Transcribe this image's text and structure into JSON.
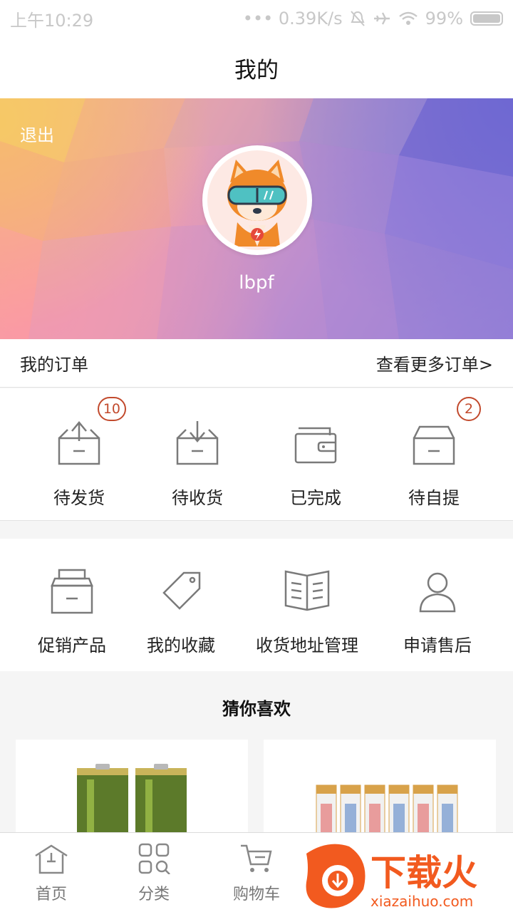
{
  "status_bar": {
    "time": "上午10:29",
    "speed": "••• 0.39K/s",
    "battery": "99%"
  },
  "header": {
    "title": "我的"
  },
  "profile": {
    "logout_label": "退出",
    "username": "lbpf"
  },
  "orders": {
    "title": "我的订单",
    "more_link": "查看更多订单>",
    "statuses": [
      {
        "label": "待发货",
        "badge": "10",
        "icon": "ship-box-icon"
      },
      {
        "label": "待收货",
        "badge": "",
        "icon": "receive-box-icon"
      },
      {
        "label": "已完成",
        "badge": "",
        "icon": "wallet-icon"
      },
      {
        "label": "待自提",
        "badge": "2",
        "icon": "pickup-box-icon"
      }
    ]
  },
  "tools": [
    {
      "label": "促销产品",
      "icon": "promo-box-icon"
    },
    {
      "label": "我的收藏",
      "icon": "tag-icon"
    },
    {
      "label": "收货地址管理",
      "icon": "book-icon"
    },
    {
      "label": "申请售后",
      "icon": "user-icon"
    }
  ],
  "recommend": {
    "title": "猜你喜欢",
    "products": [
      {
        "image": "green-battery-pair"
      },
      {
        "image": "battery-pack"
      }
    ]
  },
  "tabbar": [
    {
      "label": "首页",
      "icon": "home-icon"
    },
    {
      "label": "分类",
      "icon": "category-icon"
    },
    {
      "label": "购物车",
      "icon": "cart-icon"
    }
  ],
  "watermark": {
    "brand": "下载火",
    "url": "xiazaihuo.com"
  },
  "colors": {
    "badge": "#c24a2d",
    "icon_stroke": "#7a7a7a",
    "tab_label": "#777777",
    "watermark": "#f25a1f"
  }
}
